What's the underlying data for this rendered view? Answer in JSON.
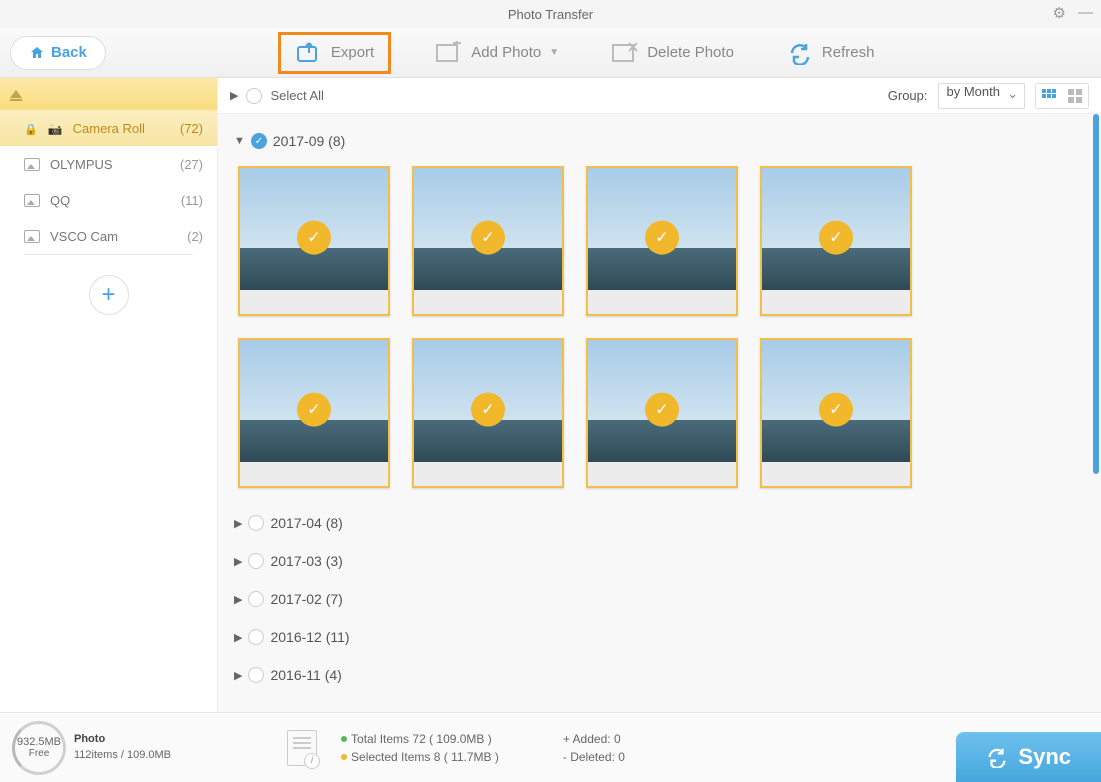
{
  "window": {
    "title": "Photo Transfer"
  },
  "toolbar": {
    "back": "Back",
    "export": "Export",
    "add_photo": "Add Photo",
    "delete_photo": "Delete Photo",
    "refresh": "Refresh"
  },
  "sidebar": {
    "albums": [
      {
        "name": "Camera Roll",
        "count": "(72)",
        "active": true,
        "locked": true
      },
      {
        "name": "OLYMPUS",
        "count": "(27)",
        "active": false,
        "locked": false
      },
      {
        "name": "QQ",
        "count": "(11)",
        "active": false,
        "locked": false
      },
      {
        "name": "VSCO Cam",
        "count": "(2)",
        "active": false,
        "locked": false
      }
    ]
  },
  "header": {
    "select_all": "Select All",
    "group_label": "Group:",
    "group_value": "by Month"
  },
  "groups": [
    {
      "label": "2017-09 (8)",
      "expanded": true,
      "checked": true,
      "photo_count": 8
    },
    {
      "label": "2017-04 (8)",
      "expanded": false,
      "checked": false
    },
    {
      "label": "2017-03 (3)",
      "expanded": false,
      "checked": false
    },
    {
      "label": "2017-02 (7)",
      "expanded": false,
      "checked": false
    },
    {
      "label": "2016-12 (11)",
      "expanded": false,
      "checked": false
    },
    {
      "label": "2016-11 (4)",
      "expanded": false,
      "checked": false
    }
  ],
  "footer": {
    "storage_size": "932.5MB",
    "storage_label": "Free",
    "section_title": "Photo",
    "section_detail": "112items / 109.0MB",
    "total_label": "Total Items",
    "total_value": "72 ( 109.0MB )",
    "selected_label": "Selected Items",
    "selected_value": "8 ( 11.7MB )",
    "added_label": "+ Added:",
    "added_value": "0",
    "deleted_label": "- Deleted:",
    "deleted_value": "0",
    "sync": "Sync"
  }
}
